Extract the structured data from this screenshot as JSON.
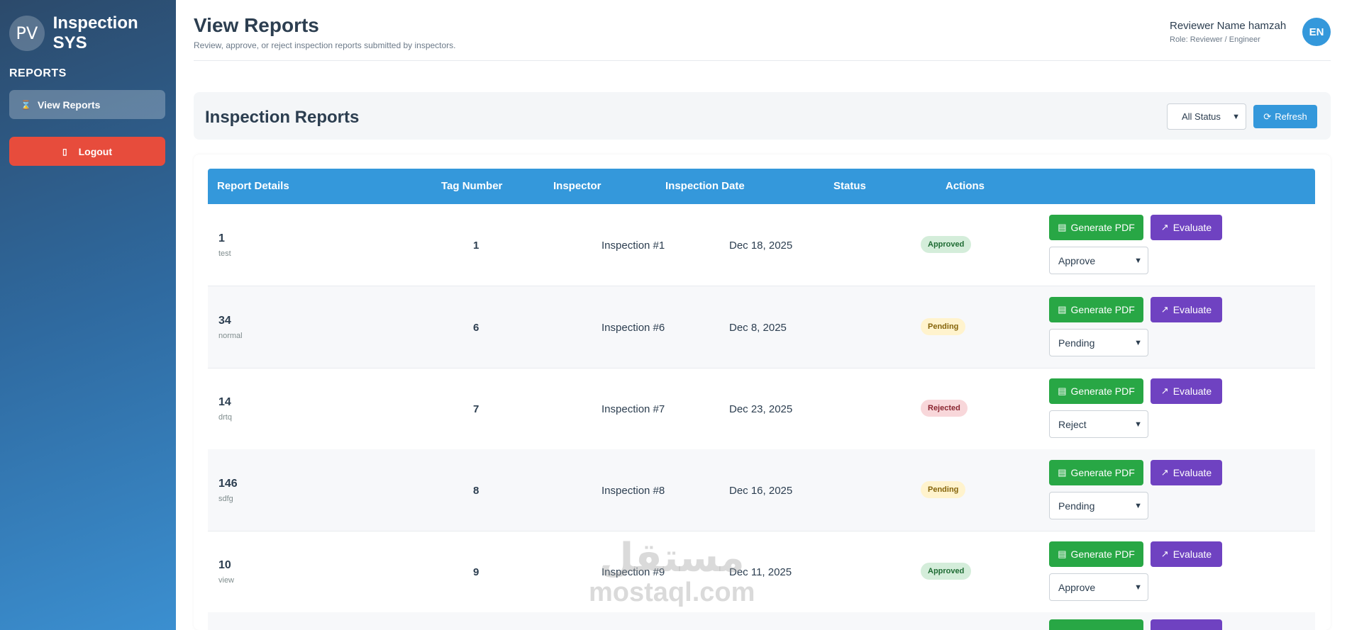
{
  "sidebar": {
    "avatar_initials": "PV",
    "brand": "Inspection SYS",
    "section_label": "REPORTS",
    "nav_item": {
      "label": "View Reports",
      "icon": "hourglass-icon"
    },
    "logout": {
      "label": "Logout",
      "icon": "door-icon"
    }
  },
  "header": {
    "title": "View Reports",
    "subtitle": "Review, approve, or reject inspection reports submitted by inspectors.",
    "user_name": "Reviewer Name hamzah",
    "user_role": "Role: Reviewer / Engineer",
    "user_initials": "EN"
  },
  "reports": {
    "title": "Inspection Reports",
    "filter_value": "All Status",
    "refresh_label": "Refresh"
  },
  "table": {
    "columns": [
      "Report Details",
      "Tag Number",
      "Inspector",
      "Inspection Date",
      "Status",
      "Actions"
    ],
    "pdf_label": "Generate PDF",
    "evaluate_label": "Evaluate",
    "rows": [
      {
        "id": "1",
        "note": "test",
        "tag": "1",
        "inspector": "Inspection #1",
        "date": "Dec 18, 2025",
        "status": "Approved",
        "action": "Approve"
      },
      {
        "id": "34",
        "note": "normal",
        "tag": "6",
        "inspector": "Inspection #6",
        "date": "Dec 8, 2025",
        "status": "Pending",
        "action": "Pending"
      },
      {
        "id": "14",
        "note": "drtq",
        "tag": "7",
        "inspector": "Inspection #7",
        "date": "Dec 23, 2025",
        "status": "Rejected",
        "action": "Reject"
      },
      {
        "id": "146",
        "note": "sdfg",
        "tag": "8",
        "inspector": "Inspection #8",
        "date": "Dec 16, 2025",
        "status": "Pending",
        "action": "Pending"
      },
      {
        "id": "10",
        "note": "view",
        "tag": "9",
        "inspector": "Inspection #9",
        "date": "Dec 11, 2025",
        "status": "Approved",
        "action": "Approve"
      }
    ]
  },
  "watermark": {
    "arabic": "مستقل",
    "latin": "mostaql.com"
  },
  "colors": {
    "accent": "#3498db",
    "logout": "#e74c3c",
    "pdf_button": "#28a745",
    "evaluate_button": "#6f42c1"
  }
}
